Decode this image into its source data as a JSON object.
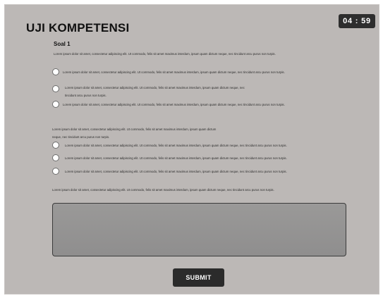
{
  "header": {
    "title": "UJI KOMPETENSI",
    "timer": "04 : 59"
  },
  "question1": {
    "label": "Soal 1",
    "prompt": "Lorem ipsum dolor sit amet, consectetur adipiscing elit. Ut commodo, felis sit amet maximus interdum, ipsum quam dictum neque, nec tincidunt arcu purus non turpis.",
    "options": [
      {
        "line1": "Lorem ipsum dolor sit amet, consectetur adipiscing elit. Ut commodo, felis sit amet maximus interdum, ipsum quam dictum neque, nec tincidunt arcu purus non turpis."
      },
      {
        "line1": "Lorem ipsum dolor sit amet, consectetur adipiscing elit. Ut commodo, felis sit amet maximus interdum, ipsum quam dictum neque, nec",
        "line2": "tincidunt arcu purus non turpis."
      },
      {
        "line1": "Lorem ipsum dolor sit amet, consectetur adipiscing elit. Ut commodo, felis sit amet maximus interdum, ipsum quam dictum neque, nec tincidunt arcu purus non turpis."
      }
    ]
  },
  "question2": {
    "prompt_line1": "Lorem ipsum dolor sit amet, consectetur adipiscing elit. Ut commodo, felis sit amet maximus interdum, ipsum quam dictum",
    "prompt_line2": "neque, nec tincidunt arcu purus non turpis.",
    "options": [
      {
        "line1": "Lorem ipsum dolor sit amet, consectetur adipiscing elit. Ut commodo, felis sit amet maximus interdum, ipsum quam dictum neque, nec tincidunt arcu purus non turpis."
      },
      {
        "line1": "Lorem ipsum dolor sit amet, consectetur adipiscing elit. Ut commodo, felis sit amet maximus interdum, ipsum quam dictum neque, nec tincidunt arcu purus non turpis."
      },
      {
        "line1": "Lorem ipsum dolor sit amet, consectetur adipiscing elit. Ut commodo, felis sit amet maximus interdum, ipsum quam dictum neque, nec tincidunt arcu purus non turpis."
      }
    ]
  },
  "question3": {
    "prompt": "Lorem ipsum dolor sit amet, consectetur adipiscing elit. Ut commodo, felis sit amet maximus interdum, ipsum quam dictum neque, nec tincidunt arcu purus non turpis.",
    "answer_value": ""
  },
  "submit_label": "SUBMIT",
  "colors": {
    "panel_bg": "#bcb8b6",
    "timer_bg": "#2e2e2e",
    "submit_bg": "#2b2b2b",
    "answer_box_bg": "#949393"
  }
}
